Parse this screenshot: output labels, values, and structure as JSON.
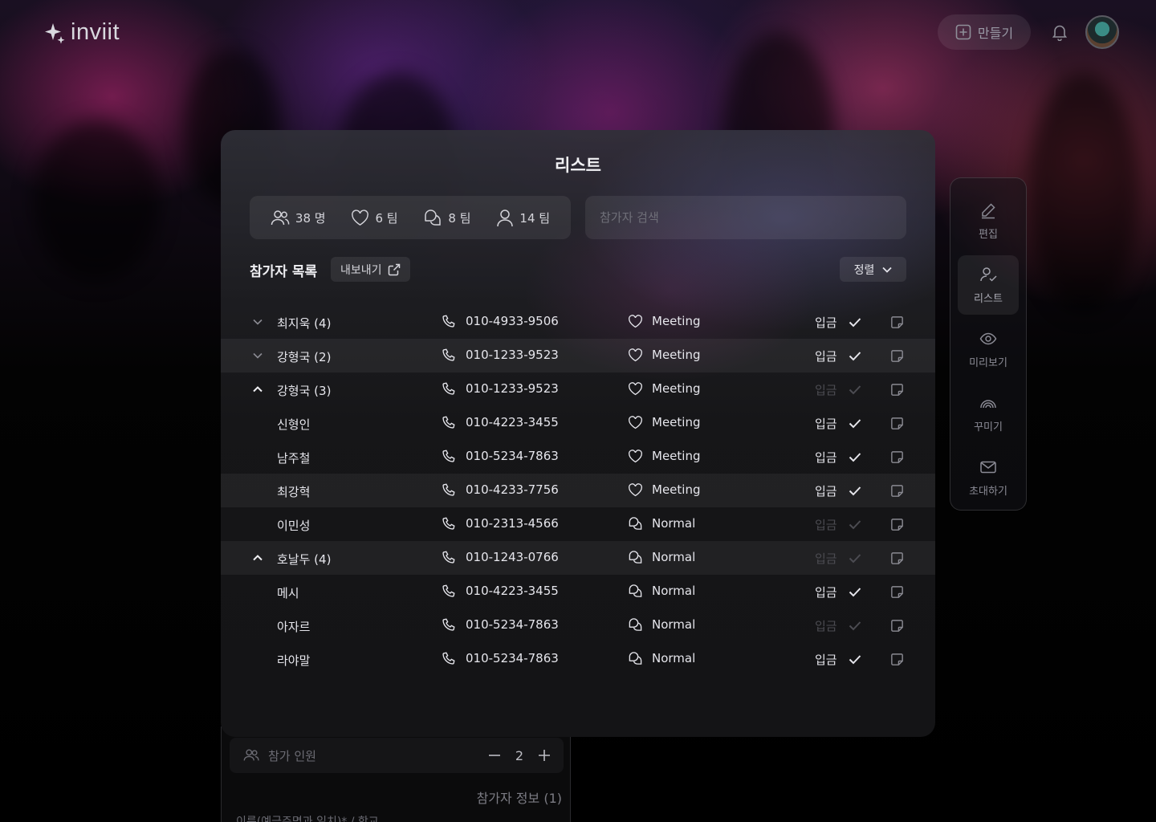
{
  "header": {
    "logo_text": "inviit",
    "create_label": "만들기",
    "icons": {
      "create": "plus-square-icon",
      "notification": "bell-icon"
    }
  },
  "sidenav": {
    "items": [
      {
        "label": "편집",
        "icon": "pencil-icon",
        "active": false
      },
      {
        "label": "리스트",
        "icon": "user-check-icon",
        "active": true
      },
      {
        "label": "미리보기",
        "icon": "eye-icon",
        "active": false
      },
      {
        "label": "꾸미기",
        "icon": "rainbow-icon",
        "active": false
      },
      {
        "label": "초대하기",
        "icon": "mail-icon",
        "active": false
      }
    ]
  },
  "modal": {
    "title": "리스트",
    "stats": [
      {
        "icon": "users-icon",
        "value": "38 명"
      },
      {
        "icon": "heart-icon",
        "value": "6 팀"
      },
      {
        "icon": "chat-icon",
        "value": "8 팀"
      },
      {
        "icon": "user-icon",
        "value": "14 팀"
      }
    ],
    "search_placeholder": "참가자 검색",
    "section_title": "참가자 목록",
    "export_label": "내보내기",
    "sort_label": "정렬",
    "rows": [
      {
        "toggle": "down",
        "name": "최지욱 (4)",
        "phone": "010-4933-9506",
        "type": "Meeting",
        "type_icon": "heart",
        "pay": "입금",
        "paid": true,
        "highlight": false
      },
      {
        "toggle": "down",
        "name": "강형국 (2)",
        "phone": "010-1233-9523",
        "type": "Meeting",
        "type_icon": "heart",
        "pay": "입금",
        "paid": true,
        "highlight": true
      },
      {
        "toggle": "up",
        "name": "강형국 (3)",
        "phone": "010-1233-9523",
        "type": "Meeting",
        "type_icon": "heart",
        "pay": "입금",
        "paid": false,
        "highlight": false
      },
      {
        "toggle": "",
        "name": "신형인",
        "phone": "010-4223-3455",
        "type": "Meeting",
        "type_icon": "heart",
        "pay": "입금",
        "paid": true,
        "highlight": false
      },
      {
        "toggle": "",
        "name": "남주철",
        "phone": "010-5234-7863",
        "type": "Meeting",
        "type_icon": "heart",
        "pay": "입금",
        "paid": true,
        "highlight": false
      },
      {
        "toggle": "",
        "name": "최강혁",
        "phone": "010-4233-7756",
        "type": "Meeting",
        "type_icon": "heart",
        "pay": "입금",
        "paid": true,
        "highlight": true
      },
      {
        "toggle": "",
        "name": "이민성",
        "phone": "010-2313-4566",
        "type": "Normal",
        "type_icon": "chat",
        "pay": "입금",
        "paid": false,
        "highlight": false
      },
      {
        "toggle": "up",
        "name": "호날두 (4)",
        "phone": "010-1243-0766",
        "type": "Normal",
        "type_icon": "chat",
        "pay": "입금",
        "paid": false,
        "highlight": true
      },
      {
        "toggle": "",
        "name": "메시",
        "phone": "010-4223-3455",
        "type": "Normal",
        "type_icon": "chat",
        "pay": "입금",
        "paid": true,
        "highlight": false
      },
      {
        "toggle": "",
        "name": "아자르",
        "phone": "010-5234-7863",
        "type": "Normal",
        "type_icon": "chat",
        "pay": "입금",
        "paid": false,
        "highlight": false
      },
      {
        "toggle": "",
        "name": "라야말",
        "phone": "010-5234-7863",
        "type": "Normal",
        "type_icon": "chat",
        "pay": "입금",
        "paid": true,
        "highlight": false
      }
    ]
  },
  "form": {
    "count_placeholder": "참가 인원",
    "count_value": "2",
    "info_label": "참가자 정보 (1)",
    "name_label": "이름(예금주명과 일치)* / 학교"
  }
}
